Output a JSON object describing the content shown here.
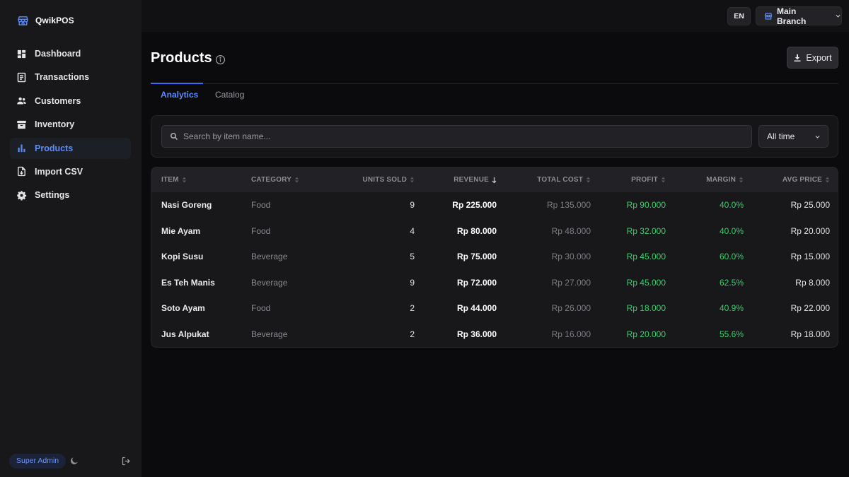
{
  "app": {
    "name": "QwikPOS",
    "brand_icon": "store-icon"
  },
  "sidebar": {
    "items": [
      {
        "label": "Dashboard",
        "icon": "dashboard-icon",
        "active": false
      },
      {
        "label": "Transactions",
        "icon": "receipt-icon",
        "active": false
      },
      {
        "label": "Customers",
        "icon": "users-icon",
        "active": false
      },
      {
        "label": "Inventory",
        "icon": "archive-icon",
        "active": false
      },
      {
        "label": "Products",
        "icon": "bar-chart-icon",
        "active": true
      },
      {
        "label": "Import CSV",
        "icon": "file-import-icon",
        "active": false
      },
      {
        "label": "Settings",
        "icon": "gear-icon",
        "active": false
      }
    ],
    "footer": {
      "role": "Super Admin"
    }
  },
  "topbar": {
    "language": "EN",
    "branch": "Main Branch"
  },
  "page": {
    "title": "Products",
    "export_label": "Export"
  },
  "tabs": [
    {
      "label": "Analytics",
      "active": true
    },
    {
      "label": "Catalog",
      "active": false
    }
  ],
  "filters": {
    "search_placeholder": "Search by item name...",
    "search_value": "",
    "time_range": "All time"
  },
  "table": {
    "columns": [
      "ITEM",
      "CATEGORY",
      "UNITS SOLD",
      "REVENUE",
      "TOTAL COST",
      "PROFIT",
      "MARGIN",
      "AVG PRICE"
    ],
    "sorted_column": "REVENUE",
    "sort_direction": "desc",
    "rows": [
      {
        "item": "Nasi Goreng",
        "category": "Food",
        "units": "9",
        "revenue": "Rp 225.000",
        "cost": "Rp 135.000",
        "profit": "Rp 90.000",
        "margin": "40.0%",
        "avg": "Rp 25.000"
      },
      {
        "item": "Mie Ayam",
        "category": "Food",
        "units": "4",
        "revenue": "Rp 80.000",
        "cost": "Rp 48.000",
        "profit": "Rp 32.000",
        "margin": "40.0%",
        "avg": "Rp 20.000"
      },
      {
        "item": "Kopi Susu",
        "category": "Beverage",
        "units": "5",
        "revenue": "Rp 75.000",
        "cost": "Rp 30.000",
        "profit": "Rp 45.000",
        "margin": "60.0%",
        "avg": "Rp 15.000"
      },
      {
        "item": "Es Teh Manis",
        "category": "Beverage",
        "units": "9",
        "revenue": "Rp 72.000",
        "cost": "Rp 27.000",
        "profit": "Rp 45.000",
        "margin": "62.5%",
        "avg": "Rp 8.000"
      },
      {
        "item": "Soto Ayam",
        "category": "Food",
        "units": "2",
        "revenue": "Rp 44.000",
        "cost": "Rp 26.000",
        "profit": "Rp 18.000",
        "margin": "40.9%",
        "avg": "Rp 22.000"
      },
      {
        "item": "Jus Alpukat",
        "category": "Beverage",
        "units": "2",
        "revenue": "Rp 36.000",
        "cost": "Rp 16.000",
        "profit": "Rp 20.000",
        "margin": "55.6%",
        "avg": "Rp 18.000"
      }
    ]
  },
  "colors": {
    "accent": "#5b8cff",
    "profit": "#35d16a",
    "background": "#0b0b0d",
    "sidebar": "#18181b"
  }
}
